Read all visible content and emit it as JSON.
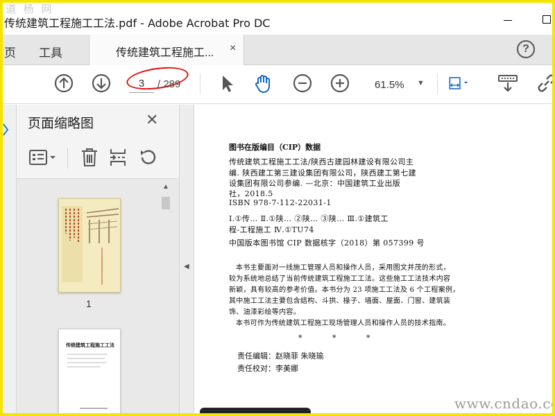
{
  "window": {
    "watermark_top": "道 杨 网",
    "title": "传统建筑工程施工工法.pdf - Adobe Acrobat Pro DC"
  },
  "tabs": {
    "home": "页",
    "tools": "工具",
    "document": "传统建筑工程施工...",
    "close": "×",
    "help": "?"
  },
  "toolbar": {
    "page_current": "3",
    "page_total": "/ 289",
    "zoom": "61.5%",
    "zoom_caret": "▼"
  },
  "panel": {
    "title": "页面缩略图",
    "close": "✕",
    "thumb1_label": "1",
    "thumb2_title": "传统建筑工程施工工法"
  },
  "document": {
    "cip_title": "图书在版编目（CIP）数据",
    "lines": [
      "传统建筑工程施工工法/陕西古建园林建设有限公司主",
      "编. 陕西建工第三建设集团有限公司，陕西建工第七建",
      "设集团有限公司参编. —北京：中国建筑工业出版",
      "社，2018.5",
      "ISBN 978-7-112-22031-1",
      "Ⅰ.①传…  Ⅱ.①陕… ②陕… ③陕…  Ⅲ.①建筑工",
      "程-工程施工  Ⅳ.①TU74",
      "中国版本图书馆 CIP 数据核字（2018）第 057399 号"
    ],
    "paragraph": [
      "本书主要面对一线施工管理人员和操作人员，采用图文并茂的形式，",
      "较为系统地总结了当前传统建筑工程施工工法。这些施工工法技术内容",
      "新颖，具有较高的参考价值。本书分为 23 项施工工法及 6 个工程案例，",
      "其中施工工法主要包含结构、斗拱、椽子、墙面、屋面、门窗、建筑装",
      "饰、油漆彩绘等内容。",
      "本书可作为传统建筑工程施工现场管理人员和操作人员的技术指南。"
    ],
    "stars": "* * *",
    "editor": "责任编辑：赵晓菲  朱晓瑜",
    "proofreader": "责任校对：李美娜"
  },
  "watermark_bottom": "www.cndao.com"
}
